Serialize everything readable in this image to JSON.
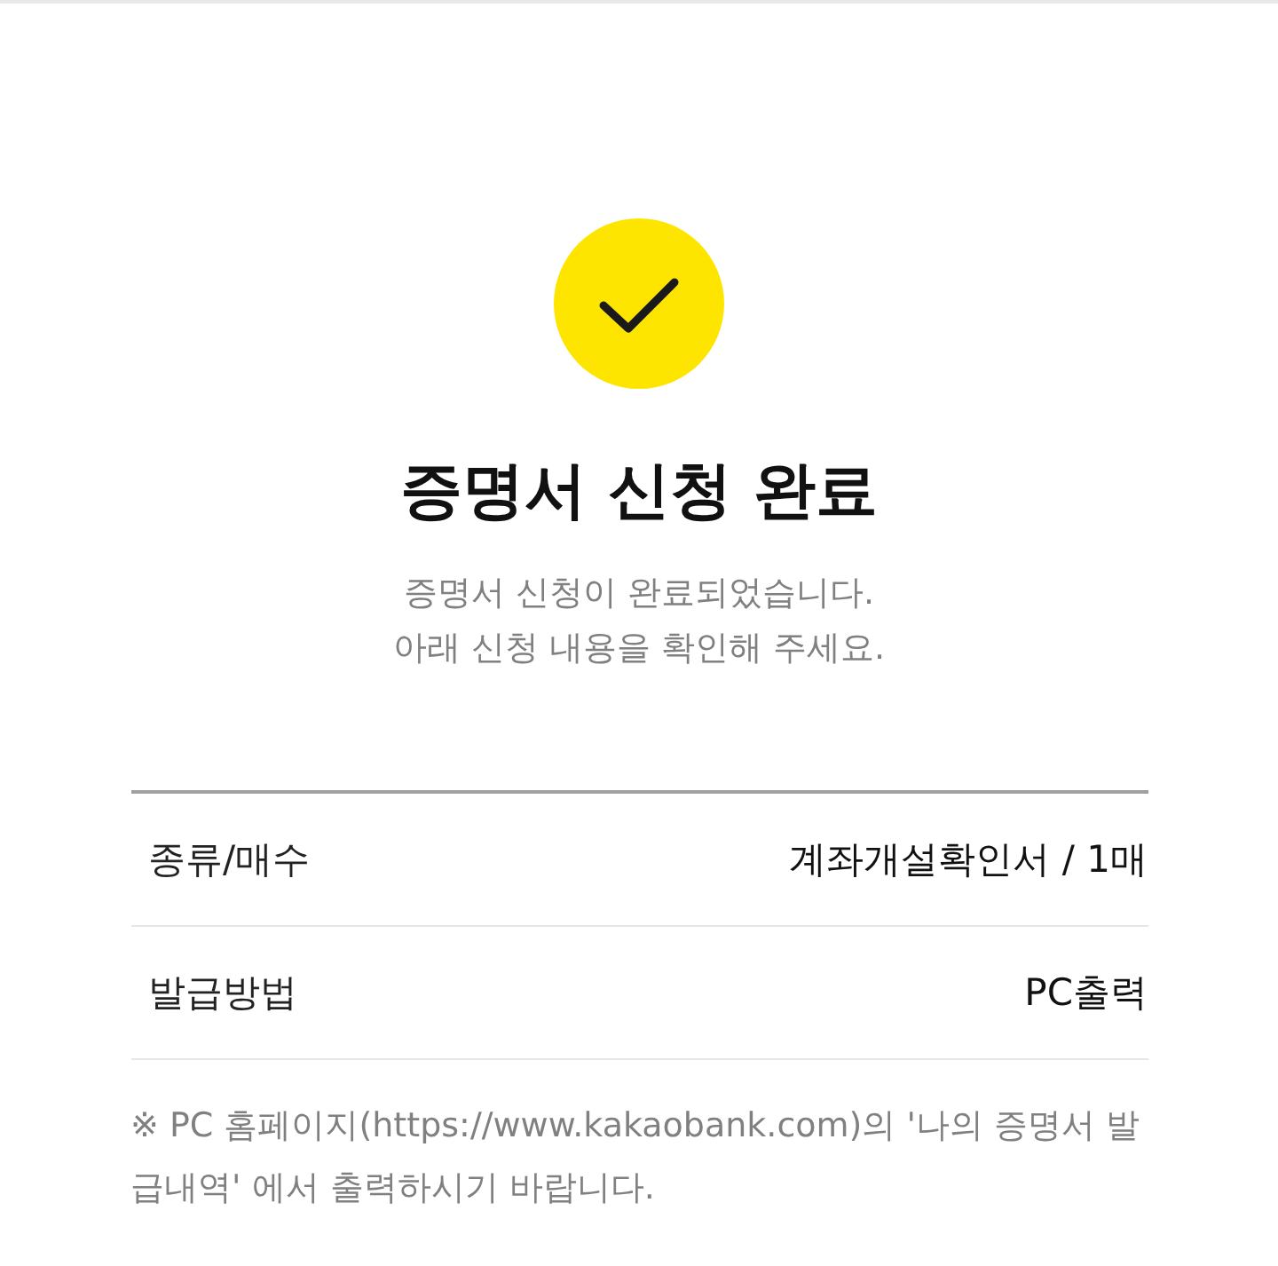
{
  "status": {
    "kind": "success",
    "title": "증명서 신청 완료",
    "message_lines": [
      "증명서 신청이 완료되었습니다.",
      "아래 신청 내용을 확인해 주세요."
    ]
  },
  "details": [
    {
      "label": "종류/매수",
      "value": "계좌개설확인서 / 1매"
    },
    {
      "label": "발급방법",
      "value": "PC출력"
    }
  ],
  "note": "※ PC 홈페이지(https://www.kakaobank.com)의 '나의 증명서 발급내역' 에서 출력하시기 바랍니다."
}
